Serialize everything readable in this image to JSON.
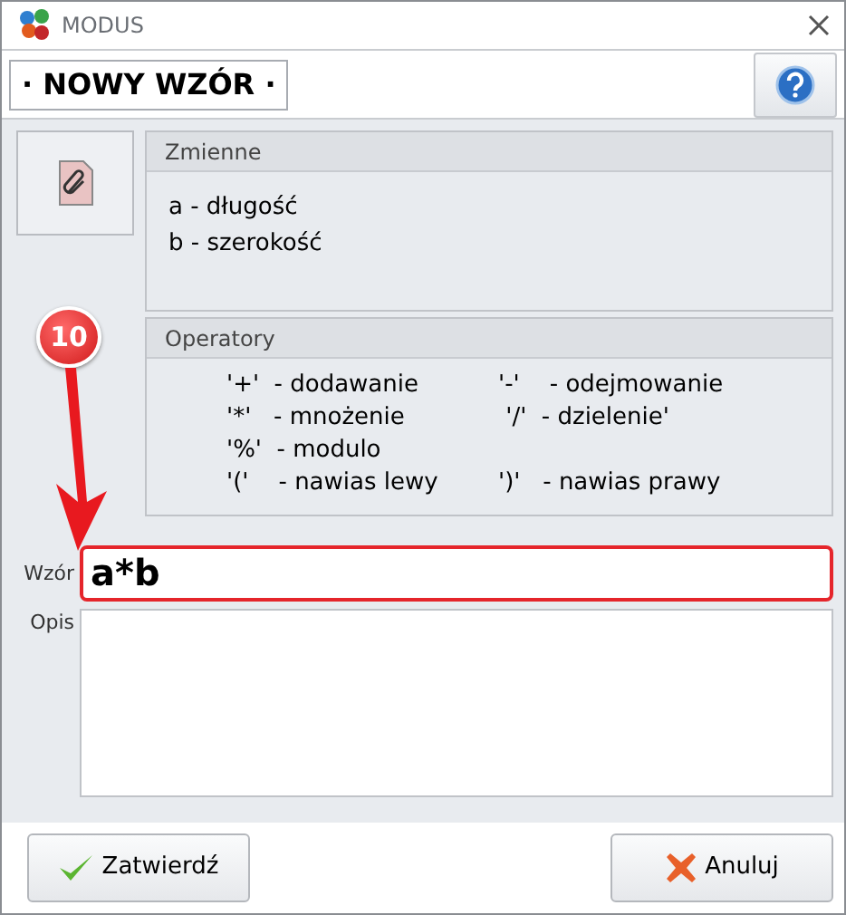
{
  "window": {
    "title": "MODUS"
  },
  "header": {
    "title": "· NOWY WZÓR ·"
  },
  "variables": {
    "title": "Zmienne",
    "lines": [
      "a - długość",
      "b - szerokość"
    ]
  },
  "operators": {
    "title": "Operatory",
    "rows": [
      {
        "left": "'+'  - dodawanie",
        "right": "'-'    - odejmowanie"
      },
      {
        "left": "'*'   - mnożenie",
        "right": " '/'  - dzielenie'"
      },
      {
        "left": "'%'  - modulo"
      },
      {
        "left": "'('    - nawias lewy",
        "right": "')'   - nawias prawy"
      }
    ]
  },
  "formula": {
    "label": "Wzór",
    "value": "a*b"
  },
  "description": {
    "label": "Opis"
  },
  "annotation": {
    "number": "10"
  },
  "buttons": [
    {
      "kind": "confirm",
      "label": "Zatwierdź"
    },
    {
      "kind": "cancel",
      "label": "Anuluj"
    }
  ]
}
